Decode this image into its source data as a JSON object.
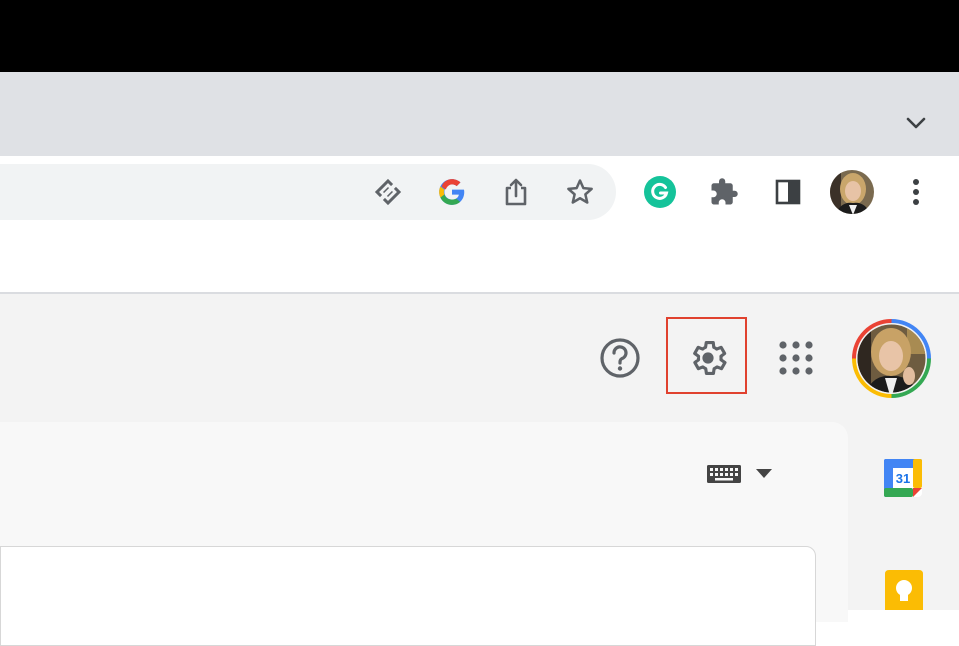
{
  "browser": {
    "toolbar": {
      "omnibox_icons": [
        "install-app-icon",
        "google-icon",
        "share-icon",
        "bookmark-star-icon"
      ],
      "extension_icons": [
        "grammarly-icon",
        "extensions-puzzle-icon",
        "side-panel-icon"
      ],
      "menu_icon": "more-vertical-icon"
    },
    "tab_strip": {
      "dropdown_icon": "chevron-down-icon"
    }
  },
  "gmail": {
    "header_icons": [
      "help-icon",
      "settings-gear-icon",
      "apps-grid-icon"
    ],
    "highlight_color": "#e0412e",
    "input_tools_icon": "keyboard-icon",
    "side_panel": {
      "calendar_day": "31"
    }
  },
  "colors": {
    "tab_strip": "#dfe1e5",
    "omnibox": "#f1f3f4",
    "gmail_bg": "#f3f3f3",
    "grammarly": "#15c39a",
    "keep_yellow": "#fbbc04",
    "calendar_blue": "#4285f4"
  }
}
